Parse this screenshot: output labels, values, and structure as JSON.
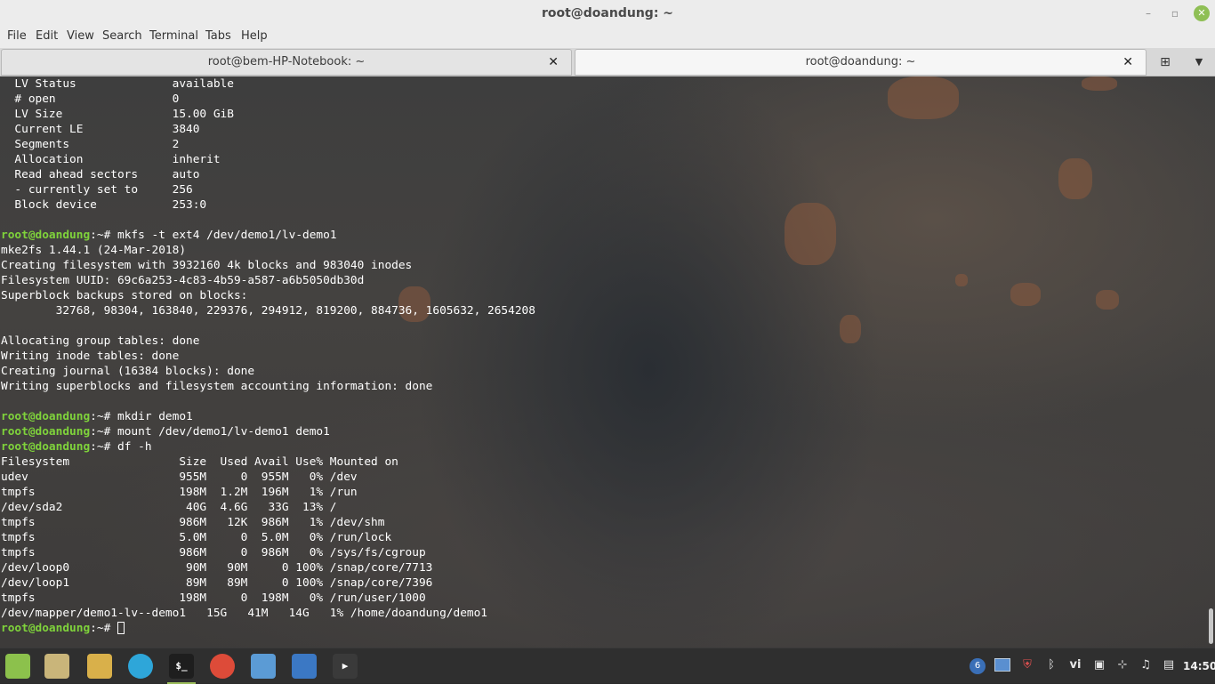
{
  "window": {
    "title": "root@doandung: ~",
    "minimize_glyph": "–",
    "maximize_glyph": "▫",
    "close_glyph": "✕"
  },
  "menu": [
    "File",
    "Edit",
    "View",
    "Search",
    "Terminal",
    "Tabs",
    "Help"
  ],
  "tabs": [
    {
      "label": "root@bem-HP-Notebook: ~",
      "close": "✕",
      "active": false
    },
    {
      "label": "root@doandung: ~",
      "close": "✕",
      "active": true
    }
  ],
  "tabbar": {
    "new_tab_glyph": "⊞",
    "menu_glyph": "▼"
  },
  "terminal": {
    "prompt_text": "root@doandung",
    "prompt_path": ":~",
    "lines": [
      {
        "prompt": false,
        "text": "  LV Status              available"
      },
      {
        "prompt": false,
        "text": "  # open                 0"
      },
      {
        "prompt": false,
        "text": "  LV Size                15.00 GiB"
      },
      {
        "prompt": false,
        "text": "  Current LE             3840"
      },
      {
        "prompt": false,
        "text": "  Segments               2"
      },
      {
        "prompt": false,
        "text": "  Allocation             inherit"
      },
      {
        "prompt": false,
        "text": "  Read ahead sectors     auto"
      },
      {
        "prompt": false,
        "text": "  - currently set to     256"
      },
      {
        "prompt": false,
        "text": "  Block device           253:0"
      },
      {
        "prompt": false,
        "text": ""
      },
      {
        "prompt": true,
        "text": "# mkfs -t ext4 /dev/demo1/lv-demo1"
      },
      {
        "prompt": false,
        "text": "mke2fs 1.44.1 (24-Mar-2018)"
      },
      {
        "prompt": false,
        "text": "Creating filesystem with 3932160 4k blocks and 983040 inodes"
      },
      {
        "prompt": false,
        "text": "Filesystem UUID: 69c6a253-4c83-4b59-a587-a6b5050db30d"
      },
      {
        "prompt": false,
        "text": "Superblock backups stored on blocks:"
      },
      {
        "prompt": false,
        "text": "        32768, 98304, 163840, 229376, 294912, 819200, 884736, 1605632, 2654208"
      },
      {
        "prompt": false,
        "text": ""
      },
      {
        "prompt": false,
        "text": "Allocating group tables: done"
      },
      {
        "prompt": false,
        "text": "Writing inode tables: done"
      },
      {
        "prompt": false,
        "text": "Creating journal (16384 blocks): done"
      },
      {
        "prompt": false,
        "text": "Writing superblocks and filesystem accounting information: done"
      },
      {
        "prompt": false,
        "text": ""
      },
      {
        "prompt": true,
        "text": "# mkdir demo1"
      },
      {
        "prompt": true,
        "text": "# mount /dev/demo1/lv-demo1 demo1"
      },
      {
        "prompt": true,
        "text": "# df -h"
      },
      {
        "prompt": false,
        "text": "Filesystem                Size  Used Avail Use% Mounted on"
      },
      {
        "prompt": false,
        "text": "udev                      955M     0  955M   0% /dev"
      },
      {
        "prompt": false,
        "text": "tmpfs                     198M  1.2M  196M   1% /run"
      },
      {
        "prompt": false,
        "text": "/dev/sda2                  40G  4.6G   33G  13% /"
      },
      {
        "prompt": false,
        "text": "tmpfs                     986M   12K  986M   1% /dev/shm"
      },
      {
        "prompt": false,
        "text": "tmpfs                     5.0M     0  5.0M   0% /run/lock"
      },
      {
        "prompt": false,
        "text": "tmpfs                     986M     0  986M   0% /sys/fs/cgroup"
      },
      {
        "prompt": false,
        "text": "/dev/loop0                 90M   90M     0 100% /snap/core/7713"
      },
      {
        "prompt": false,
        "text": "/dev/loop1                 89M   89M     0 100% /snap/core/7396"
      },
      {
        "prompt": false,
        "text": "tmpfs                     198M     0  198M   0% /run/user/1000"
      },
      {
        "prompt": false,
        "text": "/dev/mapper/demo1-lv--demo1   15G   41M   14G   1% /home/doandung/demo1"
      },
      {
        "prompt": true,
        "text": "# ",
        "cursor": true
      }
    ]
  },
  "taskbar": {
    "apps": [
      {
        "name": "mint-menu-icon",
        "color": "#8cc14c"
      },
      {
        "name": "folder-icon",
        "color": "#c9b57a"
      },
      {
        "name": "files-icon",
        "color": "#d9b04a"
      },
      {
        "name": "telegram-icon",
        "color": "#2ea6d9"
      },
      {
        "name": "terminal-icon",
        "color": "#1e1e1e",
        "glyph": "$_",
        "active": true
      },
      {
        "name": "chrome-icon",
        "color": "#dd4b39"
      },
      {
        "name": "image-viewer-icon",
        "color": "#5b9bd5"
      },
      {
        "name": "text-editor-icon",
        "color": "#3b78c4"
      },
      {
        "name": "media-player-icon",
        "color": "#3a3a3a",
        "glyph": "▶"
      }
    ],
    "tray": {
      "notifications_count": "6",
      "keyboard_layout": "vi",
      "clock": "14:50"
    }
  }
}
